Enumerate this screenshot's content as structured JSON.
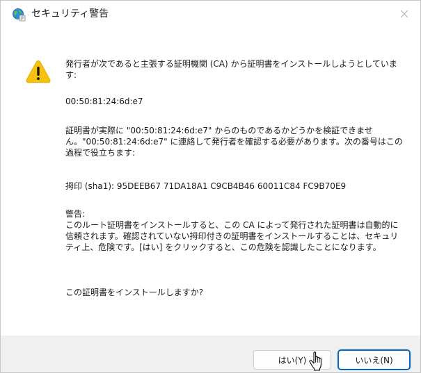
{
  "window": {
    "title": "セキュリティ警告",
    "close_icon": "close-icon",
    "title_icon": "globe-shield-icon"
  },
  "message": {
    "intro": "発行者が次であると主張する証明機関 (CA) から証明書をインストールしようとしています:",
    "serial": "00:50:81:24:6d:e7",
    "verify": "証明書が実際に \"00:50:81:24:6d:e7\" からのものであるかどうかを検証できません。\"00:50:81:24:6d:e7\" に連絡して発行者を確認する必要があります。次の番号はこの過程で役立ちます:",
    "thumbprint": "拇印 (sha1): 95DEEB67 71DA18A1 C9CB4B46 60011C84 FC9B70E9",
    "warning_heading": "警告:",
    "warning_body": "このルート証明書をインストールすると、この CA によって発行された証明書は自動的に信頼されます。確認されていない拇印付きの証明書をインストールすることは、セキュリティ上、危険です。[はい] をクリックすると、この危険を認識したことになります。",
    "question": "この証明書をインストールしますか?"
  },
  "buttons": {
    "yes": "はい(Y)",
    "no": "いいえ(N)"
  },
  "icons": {
    "warning": "warning-icon",
    "cursor": "hand-pointer-icon"
  },
  "colors": {
    "accent": "#0067c0",
    "warning_yellow": "#f6c20c",
    "footer_bg": "#f0f0f0"
  }
}
